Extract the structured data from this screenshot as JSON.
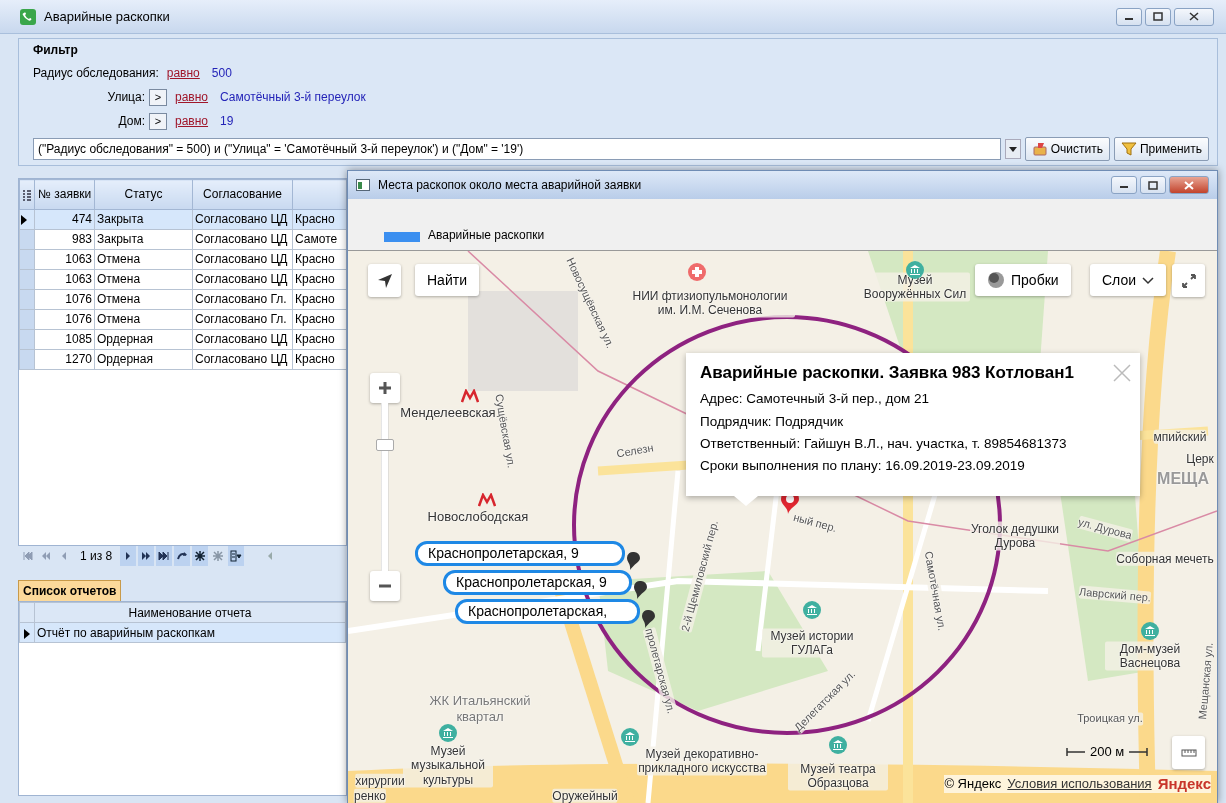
{
  "window": {
    "title": "Аварийные раскопки"
  },
  "filter": {
    "title": "Фильтр",
    "conditions": [
      {
        "label": "Радиус обследования:",
        "operator": "равно",
        "value": "500"
      },
      {
        "label": "Улица:",
        "toggle": ">",
        "operator": "равно",
        "value": "Самотёчный 3-й переулок"
      },
      {
        "label": "Дом:",
        "toggle": ">",
        "operator": "равно",
        "value": "19"
      }
    ],
    "expression": "(\"Радиус обследования\" = 500) и (\"Улица\" = 'Самотёчный 3-й переулок') и (\"Дом\" = '19')",
    "buttons": [
      {
        "kind": "clear",
        "label": "Очистить"
      },
      {
        "kind": "apply",
        "label": "Применить"
      }
    ]
  },
  "requests_table": {
    "columns": [
      "№ заявки",
      "Статус",
      "Согласование"
    ],
    "rows": [
      {
        "cells": [
          "474",
          "Закрыта",
          "Согласовано ЦД",
          "Красно"
        ],
        "selected": true
      },
      {
        "cells": [
          "983",
          "Закрыта",
          "Согласовано ЦД",
          "Самоте"
        ],
        "selected": false
      },
      {
        "cells": [
          "1063",
          "Отмена",
          "Согласовано ЦД",
          "Красно"
        ],
        "selected": false
      },
      {
        "cells": [
          "1063",
          "Отмена",
          "Согласовано ЦД",
          "Красно"
        ],
        "selected": false
      },
      {
        "cells": [
          "1076",
          "Отмена",
          "Согласовано Гл.",
          "Красно"
        ],
        "selected": false
      },
      {
        "cells": [
          "1076",
          "Отмена",
          "Согласовано Гл.",
          "Красно"
        ],
        "selected": false
      },
      {
        "cells": [
          "1085",
          "Ордерная",
          "Согласовано ЦД",
          "Красно"
        ],
        "selected": false
      },
      {
        "cells": [
          "1270",
          "Ордерная",
          "Согласовано ЦД",
          "Красно"
        ],
        "selected": false
      }
    ]
  },
  "navigator": {
    "position": "1 из 8",
    "buttons": [
      {
        "kind": "first",
        "disabled": true
      },
      {
        "kind": "prev-page",
        "disabled": true
      },
      {
        "kind": "prev",
        "disabled": true
      },
      {
        "kind": "next",
        "disabled": false
      },
      {
        "kind": "next-page",
        "disabled": false
      },
      {
        "kind": "last",
        "disabled": false
      },
      {
        "kind": "goto",
        "disabled": false
      },
      {
        "kind": "add",
        "disabled": false
      },
      {
        "kind": "delete",
        "disabled": true
      },
      {
        "kind": "columns",
        "disabled": false
      }
    ]
  },
  "reports": {
    "tab": {
      "label": "Список отчетов",
      "selected": true
    },
    "columns": [
      "Наименование отчета"
    ],
    "rows": [
      {
        "cells": [
          "Отчёт по аварийным раскопкам"
        ],
        "selected": true
      }
    ]
  },
  "map_window": {
    "title": "Места раскопок около места аварийной заявки",
    "legend": [
      {
        "label": "Аварийные раскопки",
        "color": "#3b8ff0"
      }
    ],
    "map": {
      "buttons": [
        {
          "kind": "search",
          "label": "Найти"
        },
        {
          "kind": "traffic",
          "label": "Пробки"
        },
        {
          "kind": "layers",
          "label": "Слои"
        }
      ],
      "zoom": {
        "level": 0.77
      },
      "labels": [
        {
          "kind": "poi",
          "text": "НИИ фтизиопульмонологии им. И.М. Сеченова"
        },
        {
          "kind": "poi",
          "text": "Музей Вооружённых Сил"
        },
        {
          "kind": "metro",
          "text": "Менделеевская"
        },
        {
          "kind": "metro",
          "text": "Новослободская"
        },
        {
          "kind": "street",
          "text": "Новосущёвская ул."
        },
        {
          "kind": "street",
          "text": "Сущёвская ул."
        },
        {
          "kind": "street",
          "text": "Селезн"
        },
        {
          "kind": "street",
          "text": "ный пер."
        },
        {
          "kind": "street",
          "text": "ул. Дурова"
        },
        {
          "kind": "street",
          "text": "Лаврский пер."
        },
        {
          "kind": "street",
          "text": "Самотёчная ул."
        },
        {
          "kind": "street",
          "text": "2-й Щемиловский пер."
        },
        {
          "kind": "street",
          "text": "Делегатская ул."
        },
        {
          "kind": "street",
          "text": "пролетарская ул."
        },
        {
          "kind": "street",
          "text": "Троицкая ул."
        },
        {
          "kind": "street",
          "text": "Мещанская ул."
        },
        {
          "kind": "poi",
          "text": "Уголок дедушки Дурова"
        },
        {
          "kind": "poi",
          "text": "Соборная мечеть"
        },
        {
          "kind": "poi",
          "text": "Музей истории ГУЛАГа"
        },
        {
          "kind": "poi",
          "text": "Дом-музей Васнецова"
        },
        {
          "kind": "district",
          "text": "ЖК Итальянский квартал"
        },
        {
          "kind": "poi",
          "text": "Музей музыкальной культуры"
        },
        {
          "kind": "poi",
          "text": "Музей декоративно-прикладного искусства"
        },
        {
          "kind": "poi",
          "text": "Музей театра Образцова"
        },
        {
          "kind": "poi",
          "text": "Оружейный"
        },
        {
          "kind": "poi",
          "text": "хирургии"
        },
        {
          "kind": "poi",
          "text": "ренко"
        },
        {
          "kind": "poi",
          "text": "мпийский"
        },
        {
          "kind": "poi",
          "text": "Церк"
        },
        {
          "kind": "area",
          "text": "МЕЩА"
        }
      ],
      "markers": [
        {
          "label": "Краснопролетарская, 9"
        },
        {
          "label": "Краснопролетарская, 9"
        },
        {
          "label": "Краснопролетарская,"
        }
      ],
      "balloon": {
        "title": "Аварийные раскопки. Заявка 983 Котлован1",
        "lines": [
          "Адрес: Самотечный 3-й пер., дом 21",
          "Подрядчик: Подрядчик",
          "Ответственный: Гайшун В.Л., нач. участка, т. 89854681373",
          "Сроки выполнения по плану: 16.09.2019-23.09.2019"
        ]
      },
      "scale": "200 м",
      "copyright": "© Яндекс",
      "terms_link": "Условия использования",
      "logo": "Яндекс"
    }
  }
}
